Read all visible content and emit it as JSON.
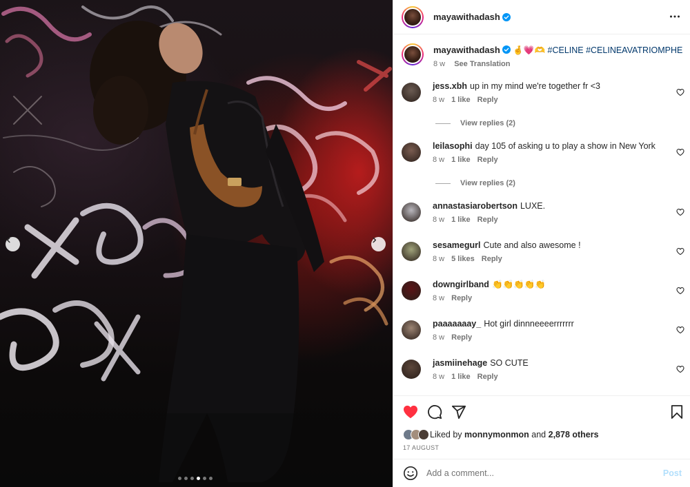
{
  "photo": {
    "carousel_dots": 6,
    "active_dot": 3
  },
  "post": {
    "username": "mayawithadash",
    "verified": true,
    "more_icon": "more-horizontal-icon"
  },
  "caption": {
    "username": "mayawithadash",
    "emoji": "🤞💗🫶",
    "hashtags": "#CELINE #CELINEAVATRIOMPHE",
    "time": "8 w",
    "see_translation": "See Translation"
  },
  "comments": [
    {
      "username": "jess.xbh",
      "text": "up in my mind we're together fr <3",
      "time": "8 w",
      "likes": "1 like",
      "reply": "Reply",
      "view_replies": "View replies (2)",
      "avatar_color": "#6b5b52"
    },
    {
      "username": "leilasophi",
      "text": "day 105 of asking u to play a show in New York",
      "time": "8 w",
      "likes": "1 like",
      "reply": "Reply",
      "view_replies": "View replies (2)",
      "avatar_color": "#7a5c50"
    },
    {
      "username": "annastasiarobertson",
      "text": "LUXE.",
      "time": "8 w",
      "likes": "1 like",
      "reply": "Reply",
      "view_replies": "",
      "avatar_color": "#b9b7bd"
    },
    {
      "username": "sesamegurl",
      "text": "Cute and also awesome !",
      "time": "8 w",
      "likes": "5 likes",
      "reply": "Reply",
      "view_replies": "",
      "avatar_color": "#a0a37a"
    },
    {
      "username": "downgirlband",
      "text": "👏👏👏👏👏",
      "time": "8 w",
      "likes": "",
      "reply": "Reply",
      "view_replies": "",
      "avatar_color": "#5a1416"
    },
    {
      "username": "paaaaaaay_",
      "text": "Hot girl dinnneeeerrrrrrr",
      "time": "8 w",
      "likes": "",
      "reply": "Reply",
      "view_replies": "",
      "avatar_color": "#9c8473"
    },
    {
      "username": "jasmiinehage",
      "text": "SO CUTE",
      "time": "8 w",
      "likes": "1 like",
      "reply": "Reply",
      "view_replies": "",
      "avatar_color": "#5c463a"
    }
  ],
  "actions": {
    "liked_by_prefix": "Liked by",
    "liked_by_user": "monnymonmon",
    "and": "and",
    "others": "2,878 others",
    "date": "17 AUGUST",
    "like_color": "#ff3040"
  },
  "add_comment": {
    "placeholder": "Add a comment...",
    "post_label": "Post"
  }
}
